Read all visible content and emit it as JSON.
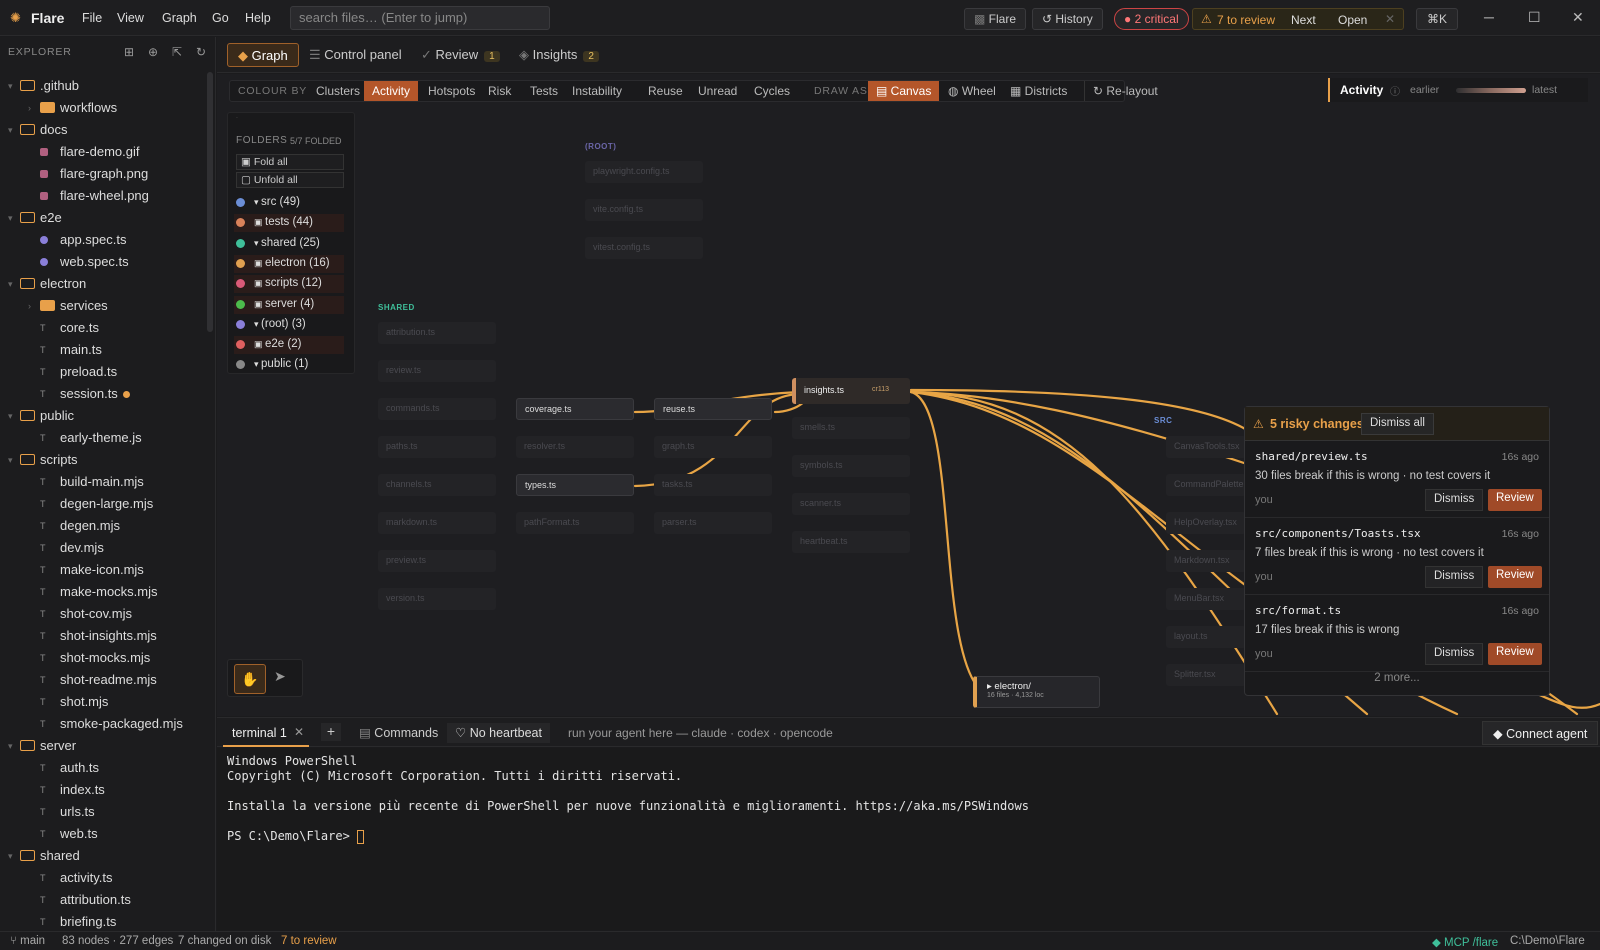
{
  "app": {
    "name": "Flare"
  },
  "menu": [
    "File",
    "View",
    "Graph",
    "Go",
    "Help"
  ],
  "search": {
    "placeholder": "search files… (Enter to jump)"
  },
  "titlebar": {
    "flare_btn": "Flare",
    "history_btn": "History",
    "critical": "2 critical",
    "to_review": "7 to review",
    "next": "Next",
    "open": "Open",
    "shortcut": "⌘K"
  },
  "sidebar": {
    "title": "EXPLORER",
    "tree": [
      {
        "label": ".github",
        "type": "folder",
        "depth": 0,
        "open": true
      },
      {
        "label": "workflows",
        "type": "folder",
        "depth": 1,
        "open": false
      },
      {
        "label": "docs",
        "type": "folder",
        "depth": 0,
        "open": true
      },
      {
        "label": "flare-demo.gif",
        "type": "image",
        "depth": 1
      },
      {
        "label": "flare-graph.png",
        "type": "image",
        "depth": 1
      },
      {
        "label": "flare-wheel.png",
        "type": "image",
        "depth": 1
      },
      {
        "label": "e2e",
        "type": "folder",
        "depth": 0,
        "open": true
      },
      {
        "label": "app.spec.ts",
        "type": "spec",
        "depth": 1
      },
      {
        "label": "web.spec.ts",
        "type": "spec",
        "depth": 1
      },
      {
        "label": "electron",
        "type": "folder",
        "depth": 0,
        "open": true
      },
      {
        "label": "services",
        "type": "folder",
        "depth": 1,
        "open": false
      },
      {
        "label": "core.ts",
        "type": "ts",
        "depth": 1
      },
      {
        "label": "main.ts",
        "type": "ts",
        "depth": 1
      },
      {
        "label": "preload.ts",
        "type": "ts",
        "depth": 1
      },
      {
        "label": "session.ts",
        "type": "ts",
        "depth": 1,
        "modified": true
      },
      {
        "label": "public",
        "type": "folder",
        "depth": 0,
        "open": true
      },
      {
        "label": "early-theme.js",
        "type": "ts",
        "depth": 1
      },
      {
        "label": "scripts",
        "type": "folder",
        "depth": 0,
        "open": true
      },
      {
        "label": "build-main.mjs",
        "type": "ts",
        "depth": 1
      },
      {
        "label": "degen-large.mjs",
        "type": "ts",
        "depth": 1
      },
      {
        "label": "degen.mjs",
        "type": "ts",
        "depth": 1
      },
      {
        "label": "dev.mjs",
        "type": "ts",
        "depth": 1
      },
      {
        "label": "make-icon.mjs",
        "type": "ts",
        "depth": 1
      },
      {
        "label": "make-mocks.mjs",
        "type": "ts",
        "depth": 1
      },
      {
        "label": "shot-cov.mjs",
        "type": "ts",
        "depth": 1
      },
      {
        "label": "shot-insights.mjs",
        "type": "ts",
        "depth": 1
      },
      {
        "label": "shot-mocks.mjs",
        "type": "ts",
        "depth": 1
      },
      {
        "label": "shot-readme.mjs",
        "type": "ts",
        "depth": 1
      },
      {
        "label": "shot.mjs",
        "type": "ts",
        "depth": 1
      },
      {
        "label": "smoke-packaged.mjs",
        "type": "ts",
        "depth": 1
      },
      {
        "label": "server",
        "type": "folder",
        "depth": 0,
        "open": true
      },
      {
        "label": "auth.ts",
        "type": "ts",
        "depth": 1
      },
      {
        "label": "index.ts",
        "type": "ts",
        "depth": 1
      },
      {
        "label": "urls.ts",
        "type": "ts",
        "depth": 1
      },
      {
        "label": "web.ts",
        "type": "ts",
        "depth": 1
      },
      {
        "label": "shared",
        "type": "folder",
        "depth": 0,
        "open": true
      },
      {
        "label": "activity.ts",
        "type": "ts",
        "depth": 1
      },
      {
        "label": "attribution.ts",
        "type": "ts",
        "depth": 1
      },
      {
        "label": "briefing.ts",
        "type": "ts",
        "depth": 1
      }
    ]
  },
  "tabs": [
    {
      "label": "Graph",
      "badge": ""
    },
    {
      "label": "Control panel",
      "badge": ""
    },
    {
      "label": "Review",
      "badge": "1"
    },
    {
      "label": "Insights",
      "badge": "2"
    }
  ],
  "toolbar": {
    "colour_by_label": "COLOUR BY",
    "colour_by": [
      "Clusters",
      "Activity",
      "Hotspots",
      "Risk",
      "Tests",
      "Instability",
      "Reuse",
      "Unread",
      "Cycles"
    ],
    "colour_selected": "Activity",
    "draw_as_label": "DRAW AS",
    "draw_as": [
      "Canvas",
      "Wheel",
      "Districts"
    ],
    "draw_selected": "Canvas",
    "relayout": "Re-layout",
    "activity_label": "Activity",
    "earlier": "earlier",
    "latest": "latest"
  },
  "legend": {
    "title": "FOLDERS",
    "folded": "5/7 FOLDED",
    "fold_all": "Fold all",
    "unfold_all": "Unfold all",
    "items": [
      {
        "label": "src (49)",
        "color": "#6b8ed6",
        "mark": "▾"
      },
      {
        "label": "tests (44)",
        "color": "#d9825a",
        "mark": "▣",
        "hot": true
      },
      {
        "label": "shared (25)",
        "color": "#3fbf9a",
        "mark": "▾"
      },
      {
        "label": "electron (16)",
        "color": "#e0a050",
        "mark": "▣",
        "hot": true
      },
      {
        "label": "scripts (12)",
        "color": "#d95a78",
        "mark": "▣",
        "hot": true
      },
      {
        "label": "server (4)",
        "color": "#4cbb4c",
        "mark": "▣",
        "hot": true
      },
      {
        "label": "(root) (3)",
        "color": "#8a7fd9",
        "mark": "▾"
      },
      {
        "label": "e2e (2)",
        "color": "#e06060",
        "mark": "▣",
        "hot": true
      },
      {
        "label": "public (1)",
        "color": "#888888",
        "mark": "▾"
      }
    ]
  },
  "graph": {
    "groups": {
      "root": "(ROOT)",
      "shared": "SHARED",
      "src": "SRC"
    },
    "root_nodes": [
      "playwright.config.ts",
      "vite.config.ts",
      "vitest.config.ts"
    ],
    "shared_col1": [
      "attribution.ts",
      "review.ts",
      "commands.ts",
      "paths.ts",
      "channels.ts",
      "markdown.ts",
      "preview.ts",
      "version.ts"
    ],
    "shared_col2": [
      "coverage.ts",
      "resolver.ts",
      "types.ts",
      "pathFormat.ts"
    ],
    "shared_col3": [
      "reuse.ts",
      "graph.ts",
      "tasks.ts",
      "parser.ts"
    ],
    "shared_col4": [
      "insights.ts",
      "smells.ts",
      "symbols.ts",
      "scanner.ts",
      "heartbeat.ts"
    ],
    "src_nodes": [
      "CanvasTools.tsx",
      "CommandPalette.tsx",
      "HelpOverlay.tsx",
      "Markdown.tsx",
      "MenuBar.tsx",
      "layout.ts",
      "Splitter.tsx"
    ],
    "insights_meta": "cr113",
    "electron_node": "electron/",
    "electron_meta": "16 files · 4,132 loc"
  },
  "risk": {
    "title": "5 risky changes",
    "dismiss_all": "Dismiss all",
    "items": [
      {
        "path": "shared/preview.ts",
        "ago": "16s ago",
        "desc": "30 files break if this is wrong · no test covers it",
        "by": "you"
      },
      {
        "path": "src/components/Toasts.tsx",
        "ago": "16s ago",
        "desc": "7 files break if this is wrong · no test covers it",
        "by": "you"
      },
      {
        "path": "src/format.ts",
        "ago": "16s ago",
        "desc": "17 files break if this is wrong",
        "by": "you"
      }
    ],
    "dismiss": "Dismiss",
    "review": "Review",
    "more": "2 more..."
  },
  "terminal": {
    "tab": "terminal 1",
    "commands": "Commands",
    "heartbeat": "No heartbeat",
    "hint": "run your agent here — claude · codex · opencode",
    "connect": "Connect agent",
    "lines": [
      "Windows PowerShell",
      "Copyright (C) Microsoft Corporation. Tutti i diritti riservati.",
      "",
      "Installa la versione più recente di PowerShell per nuove funzionalità e miglioramenti. https://aka.ms/PSWindows",
      "",
      "PS C:\\Demo\\Flare> "
    ]
  },
  "status": {
    "branch": "main",
    "counts": "83 nodes · 277 edges",
    "changed": "7 changed on disk",
    "to_review": "7 to review",
    "mcp": "MCP /flare",
    "path": "C:\\Demo\\Flare"
  },
  "colors": {
    "accent": "#e8a04a",
    "select": "#b4562a",
    "edge": "#e8a545"
  }
}
